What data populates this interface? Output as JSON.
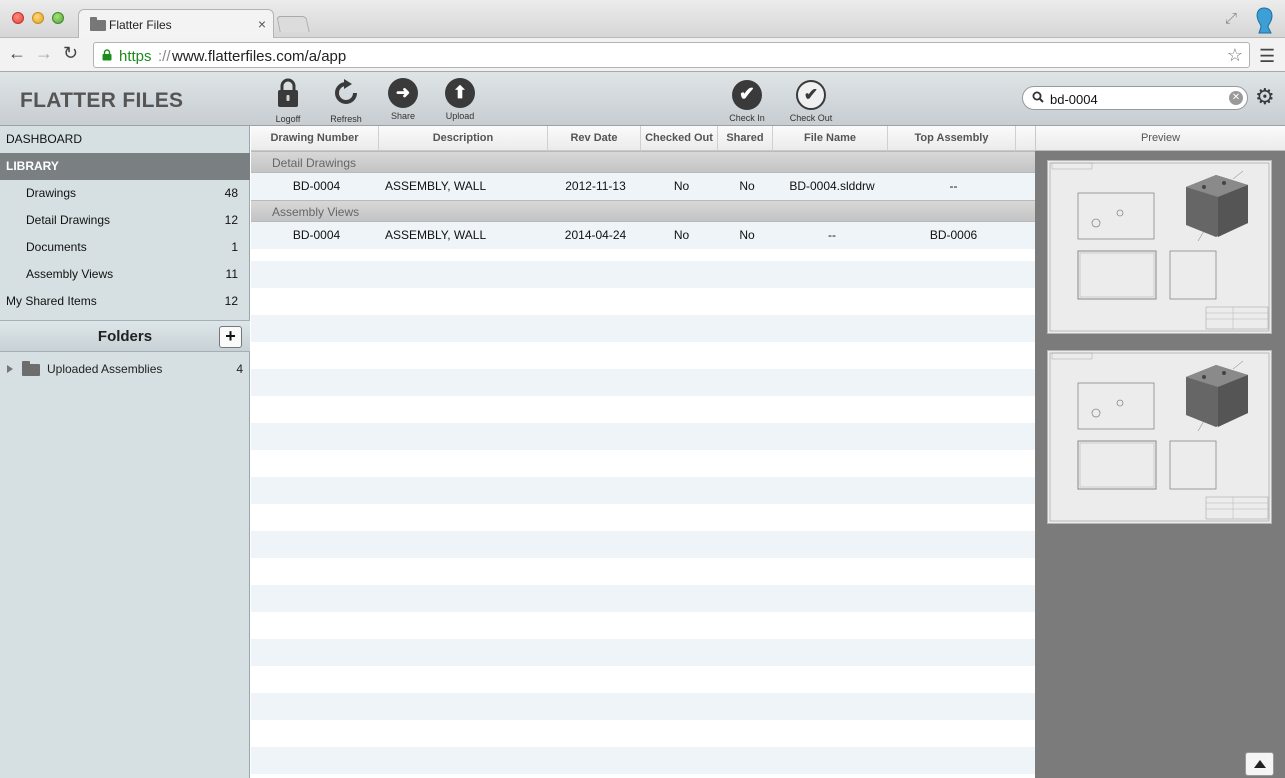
{
  "browser": {
    "tab_title": "Flatter Files",
    "tab_close": "×",
    "url_scheme": "https",
    "url_sep": "://",
    "url_rest": "www.flatterfiles.com/a/app"
  },
  "app": {
    "title": "FLATTER FILES",
    "toolbar": {
      "logoff": "Logoff",
      "refresh": "Refresh",
      "share": "Share",
      "upload": "Upload",
      "check_in": "Check In",
      "check_out": "Check Out"
    },
    "search": {
      "value": "bd-0004"
    }
  },
  "sidebar": {
    "dashboard": "DASHBOARD",
    "library": "LIBRARY",
    "items": [
      {
        "label": "Drawings",
        "count": "48"
      },
      {
        "label": "Detail Drawings",
        "count": "12"
      },
      {
        "label": "Documents",
        "count": "1"
      },
      {
        "label": "Assembly Views",
        "count": "11"
      }
    ],
    "shared": {
      "label": "My Shared Items",
      "count": "12"
    },
    "folders_title": "Folders",
    "add_folder": "+",
    "folders": [
      {
        "name": "Uploaded Assemblies",
        "count": "4"
      }
    ]
  },
  "table": {
    "columns": [
      "Drawing Number",
      "Description",
      "Rev Date",
      "Checked Out",
      "Shared",
      "File Name",
      "Top Assembly"
    ],
    "groups": [
      {
        "name": "Detail Drawings",
        "rows": [
          {
            "number": "BD-0004",
            "description": "ASSEMBLY, WALL",
            "rev_date": "2012-11-13",
            "checked_out": "No",
            "shared": "No",
            "file_name": "BD-0004.slddrw",
            "top_assembly": "--"
          }
        ]
      },
      {
        "name": "Assembly Views",
        "rows": [
          {
            "number": "BD-0004",
            "description": "ASSEMBLY, WALL",
            "rev_date": "2014-04-24",
            "checked_out": "No",
            "shared": "No",
            "file_name": "--",
            "top_assembly": "BD-0006"
          }
        ]
      }
    ]
  },
  "preview": {
    "title": "Preview"
  },
  "colors": {
    "accent_green": "#1c8c1c",
    "selected_row": "#7a7f82",
    "sidebar_bg": "#d6e0e3"
  }
}
